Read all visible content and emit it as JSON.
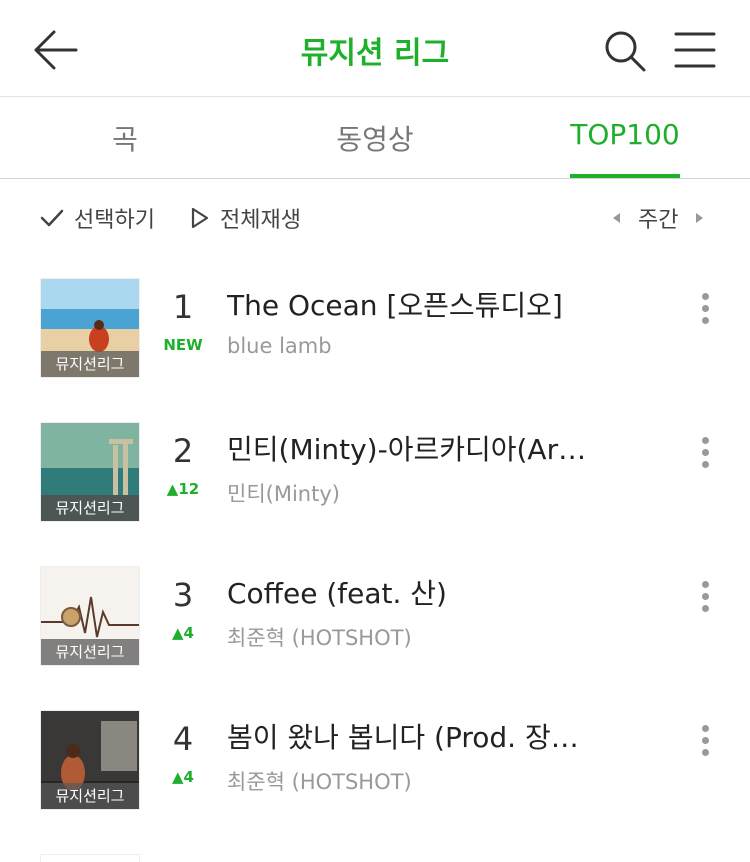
{
  "header": {
    "title": "뮤지션 리그",
    "back_icon": "arrow-left-icon",
    "search_icon": "search-icon",
    "menu_icon": "menu-icon"
  },
  "tabs": [
    {
      "label": "곡",
      "active": false
    },
    {
      "label": "동영상",
      "active": false
    },
    {
      "label": "TOP100",
      "active": true
    }
  ],
  "toolbar": {
    "select_label": "선택하기",
    "play_all_label": "전체재생",
    "period_label": "주간"
  },
  "colors": {
    "accent": "#1fb02b",
    "secondary_text": "#999999"
  },
  "thumb_label": "뮤지션리그",
  "tracks": [
    {
      "rank": "1",
      "change": "NEW",
      "title": "The Ocean  [오픈스튜디오]",
      "artist": "blue lamb"
    },
    {
      "rank": "2",
      "change": "▲12",
      "title": "민티(Minty)-아르카디아(Ar…",
      "artist": "민티(Minty)"
    },
    {
      "rank": "3",
      "change": "▲4",
      "title": "Coffee (feat. 산)",
      "artist": "최준혁 (HOTSHOT)"
    },
    {
      "rank": "4",
      "change": "▲4",
      "title": "봄이 왔나 봅니다 (Prod. 장…",
      "artist": "최준혁 (HOTSHOT)"
    }
  ]
}
